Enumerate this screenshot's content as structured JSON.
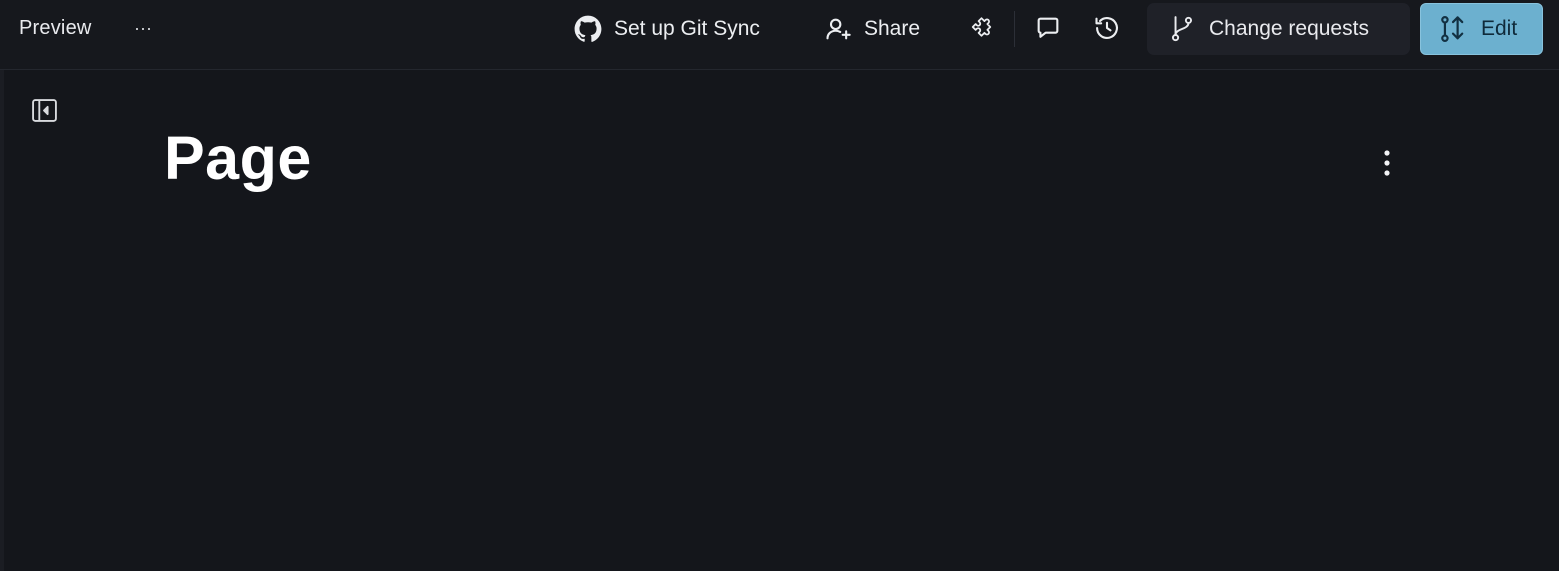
{
  "topbar": {
    "preview_label": "Preview",
    "more_label": "···",
    "git_sync_label": "Set up Git Sync",
    "share_label": "Share",
    "change_requests_label": "Change requests",
    "edit_label": "Edit",
    "icons": {
      "more": "more-horizontal-icon",
      "git_sync": "github-icon",
      "share": "user-plus-icon",
      "integrations": "puzzle-icon",
      "comments": "comment-icon",
      "history": "history-icon",
      "change_requests": "git-branch-icon",
      "edit": "git-merge-edit-icon"
    }
  },
  "content": {
    "page_title": "Page",
    "icons": {
      "sidebar_toggle": "sidebar-collapse-icon",
      "page_menu": "more-vertical-icon"
    }
  },
  "colors": {
    "background": "#14161b",
    "topbar": "#16181d",
    "secondary_button": "#1f2128",
    "primary_button": "#6cb0cf",
    "text": "#e9eaee"
  }
}
